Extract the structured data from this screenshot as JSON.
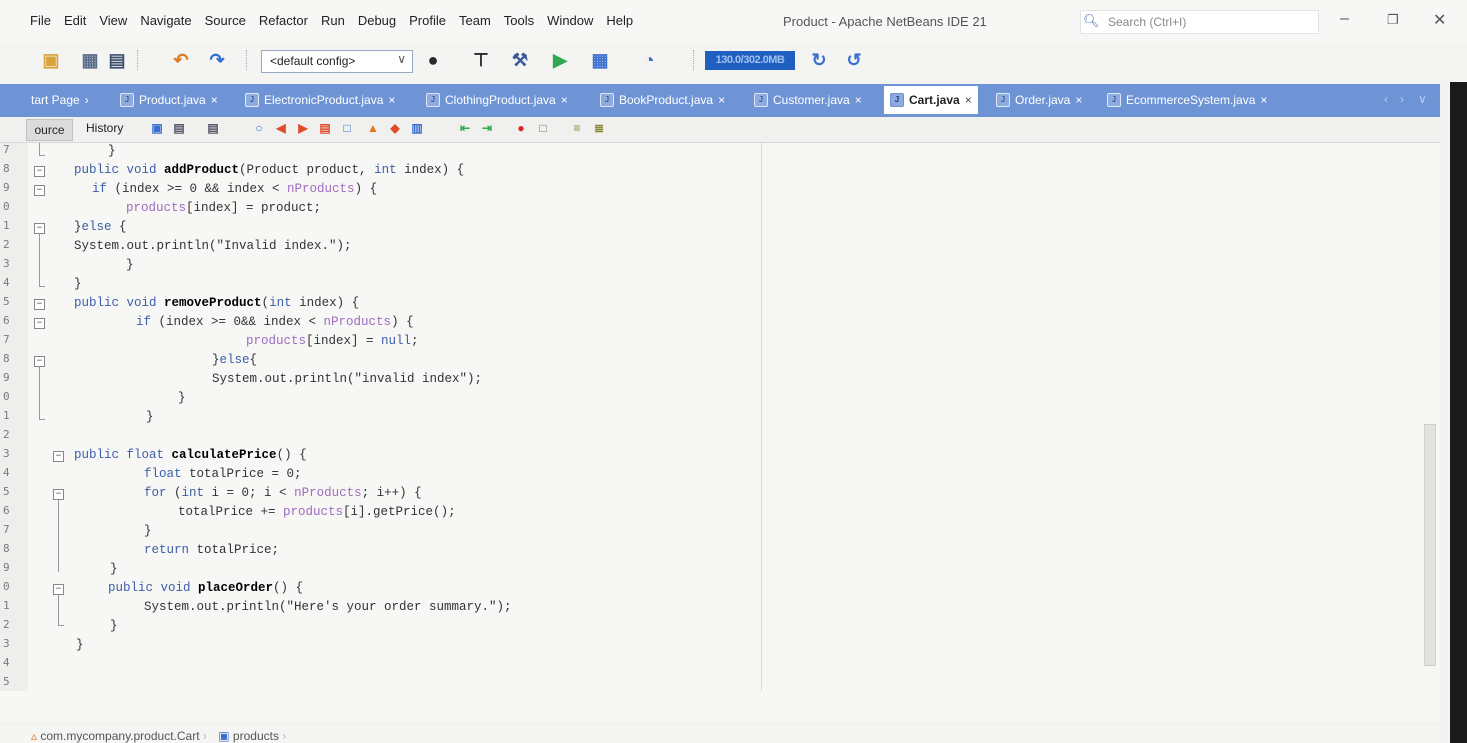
{
  "menu": [
    "File",
    "Edit",
    "View",
    "Navigate",
    "Source",
    "Refactor",
    "Run",
    "Debug",
    "Profile",
    "Team",
    "Tools",
    "Window",
    "Help"
  ],
  "window_title": "Product - Apache NetBeans IDE 21",
  "search_placeholder": "Search (Ctrl+I)",
  "toolbar": {
    "config": "<default config>",
    "memory": "130.0/302.0MB"
  },
  "tabs": [
    {
      "label": "tart Page",
      "icon": "home-icon"
    },
    {
      "label": "Product.java",
      "icon": "java-file-icon"
    },
    {
      "label": "ElectronicProduct.java",
      "icon": "java-file-icon"
    },
    {
      "label": "ClothingProduct.java",
      "icon": "java-file-icon"
    },
    {
      "label": "BookProduct.java",
      "icon": "java-file-icon"
    },
    {
      "label": "Customer.java",
      "icon": "java-file-icon"
    },
    {
      "label": "Cart.java",
      "icon": "java-file-icon",
      "active": true
    },
    {
      "label": "Order.java",
      "icon": "java-file-icon"
    },
    {
      "label": "EcommerceSystem.java",
      "icon": "java-main-file-icon"
    }
  ],
  "editor_tabs": {
    "source": "ource",
    "history": "History"
  },
  "line_numbers": [
    "7",
    "8",
    "9",
    "0",
    "1",
    "2",
    "3",
    "4",
    "5",
    "6",
    "7",
    "8",
    "9",
    "0",
    "1",
    "2",
    "3",
    "4",
    "5",
    "6",
    "7",
    "8",
    "9",
    "0",
    "1",
    "2",
    "3",
    "4",
    "5"
  ],
  "code_lines": [
    "}",
    "public void addProduct(Product product, int index) {",
    "if (index >= 0 && index < nProducts) {",
    "products[index] = product;",
    "}else {",
    "System.out.println(\"Invalid index.\");",
    "}",
    "}",
    "public void removeProduct(int index) {",
    "if (index >= 0&& index < nProducts) {",
    "products[index] = null;",
    "}else{",
    "System.out.println(\"invalid index\");",
    "}",
    "}",
    "",
    "public float calculatePrice() {",
    "float totalPrice = 0;",
    "for (int i = 0; i < nProducts; i++) {",
    "totalPrice += products[i].getPrice();",
    "}",
    "return totalPrice;",
    "}",
    "public void placeOrder() {",
    "System.out.println(\"Here's your order summary.\");",
    "}",
    "}",
    "",
    ""
  ],
  "breadcrumb": {
    "class": "com.mycompany.product.Cart",
    "member": "products"
  }
}
